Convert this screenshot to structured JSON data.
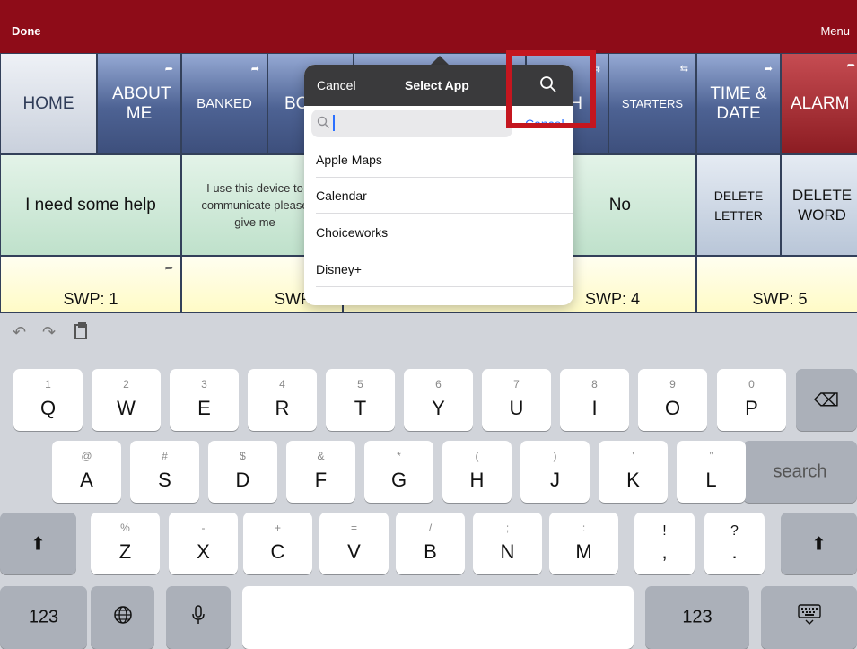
{
  "topbar": {
    "done": "Done",
    "menu": "Menu"
  },
  "grid": {
    "row1": {
      "home": "HOME",
      "about_me": "ABOUT ME",
      "banked": "BANKED",
      "bo": "BO",
      "ch": "CH",
      "starters": "STARTERS",
      "time_date": "TIME & DATE",
      "alarm": "ALARM"
    },
    "row2": {
      "need_help": "I need some help",
      "device_msg": "I use this device to communicate please give me",
      "no": "No",
      "delete_letter": "DELETE LETTER",
      "delete_word": "DELETE WORD"
    },
    "row3": [
      "SWP: 1",
      "SWP: 2",
      "SWP: 4",
      "SWP: 5"
    ]
  },
  "popover": {
    "cancel": "Cancel",
    "title": "Select App",
    "search_placeholder": "",
    "cancel_under": "Cancel",
    "apps": [
      "Apple Maps",
      "Calendar",
      "Choiceworks",
      "Disney+"
    ]
  },
  "keyboard": {
    "row1": [
      {
        "main": "Q",
        "sub": "1"
      },
      {
        "main": "W",
        "sub": "2"
      },
      {
        "main": "E",
        "sub": "3"
      },
      {
        "main": "R",
        "sub": "4"
      },
      {
        "main": "T",
        "sub": "5"
      },
      {
        "main": "Y",
        "sub": "6"
      },
      {
        "main": "U",
        "sub": "7"
      },
      {
        "main": "I",
        "sub": "8"
      },
      {
        "main": "O",
        "sub": "9"
      },
      {
        "main": "P",
        "sub": "0"
      }
    ],
    "row2": [
      {
        "main": "A",
        "sub": "@"
      },
      {
        "main": "S",
        "sub": "#"
      },
      {
        "main": "D",
        "sub": "$"
      },
      {
        "main": "F",
        "sub": "&"
      },
      {
        "main": "G",
        "sub": "*"
      },
      {
        "main": "H",
        "sub": "("
      },
      {
        "main": "J",
        "sub": ")"
      },
      {
        "main": "K",
        "sub": "’"
      },
      {
        "main": "L",
        "sub": "”"
      }
    ],
    "row3": [
      {
        "main": "Z",
        "sub": "%"
      },
      {
        "main": "X",
        "sub": "-"
      },
      {
        "main": "C",
        "sub": "+"
      },
      {
        "main": "V",
        "sub": "="
      },
      {
        "main": "B",
        "sub": "/"
      },
      {
        "main": "N",
        "sub": ";"
      },
      {
        "main": "M",
        "sub": ":"
      }
    ],
    "punct1": {
      "main": ",",
      "sub": "!"
    },
    "punct2": {
      "main": ".",
      "sub": "?"
    },
    "search": "search",
    "num_left": "123",
    "num_right": "123"
  },
  "icons": {
    "nav_corner": "share-arrow-icon",
    "search": "search-icon",
    "backspace": "backspace-icon",
    "shift": "shift-icon",
    "globe": "globe-icon",
    "mic": "microphone-icon",
    "hide_keyboard": "keyboard-hide-icon",
    "undo": "undo-icon",
    "redo": "redo-icon",
    "paste": "paste-icon"
  },
  "colors": {
    "topbar": "#8e0c18",
    "highlight": "#c4161f",
    "caret": "#2c70ff"
  }
}
